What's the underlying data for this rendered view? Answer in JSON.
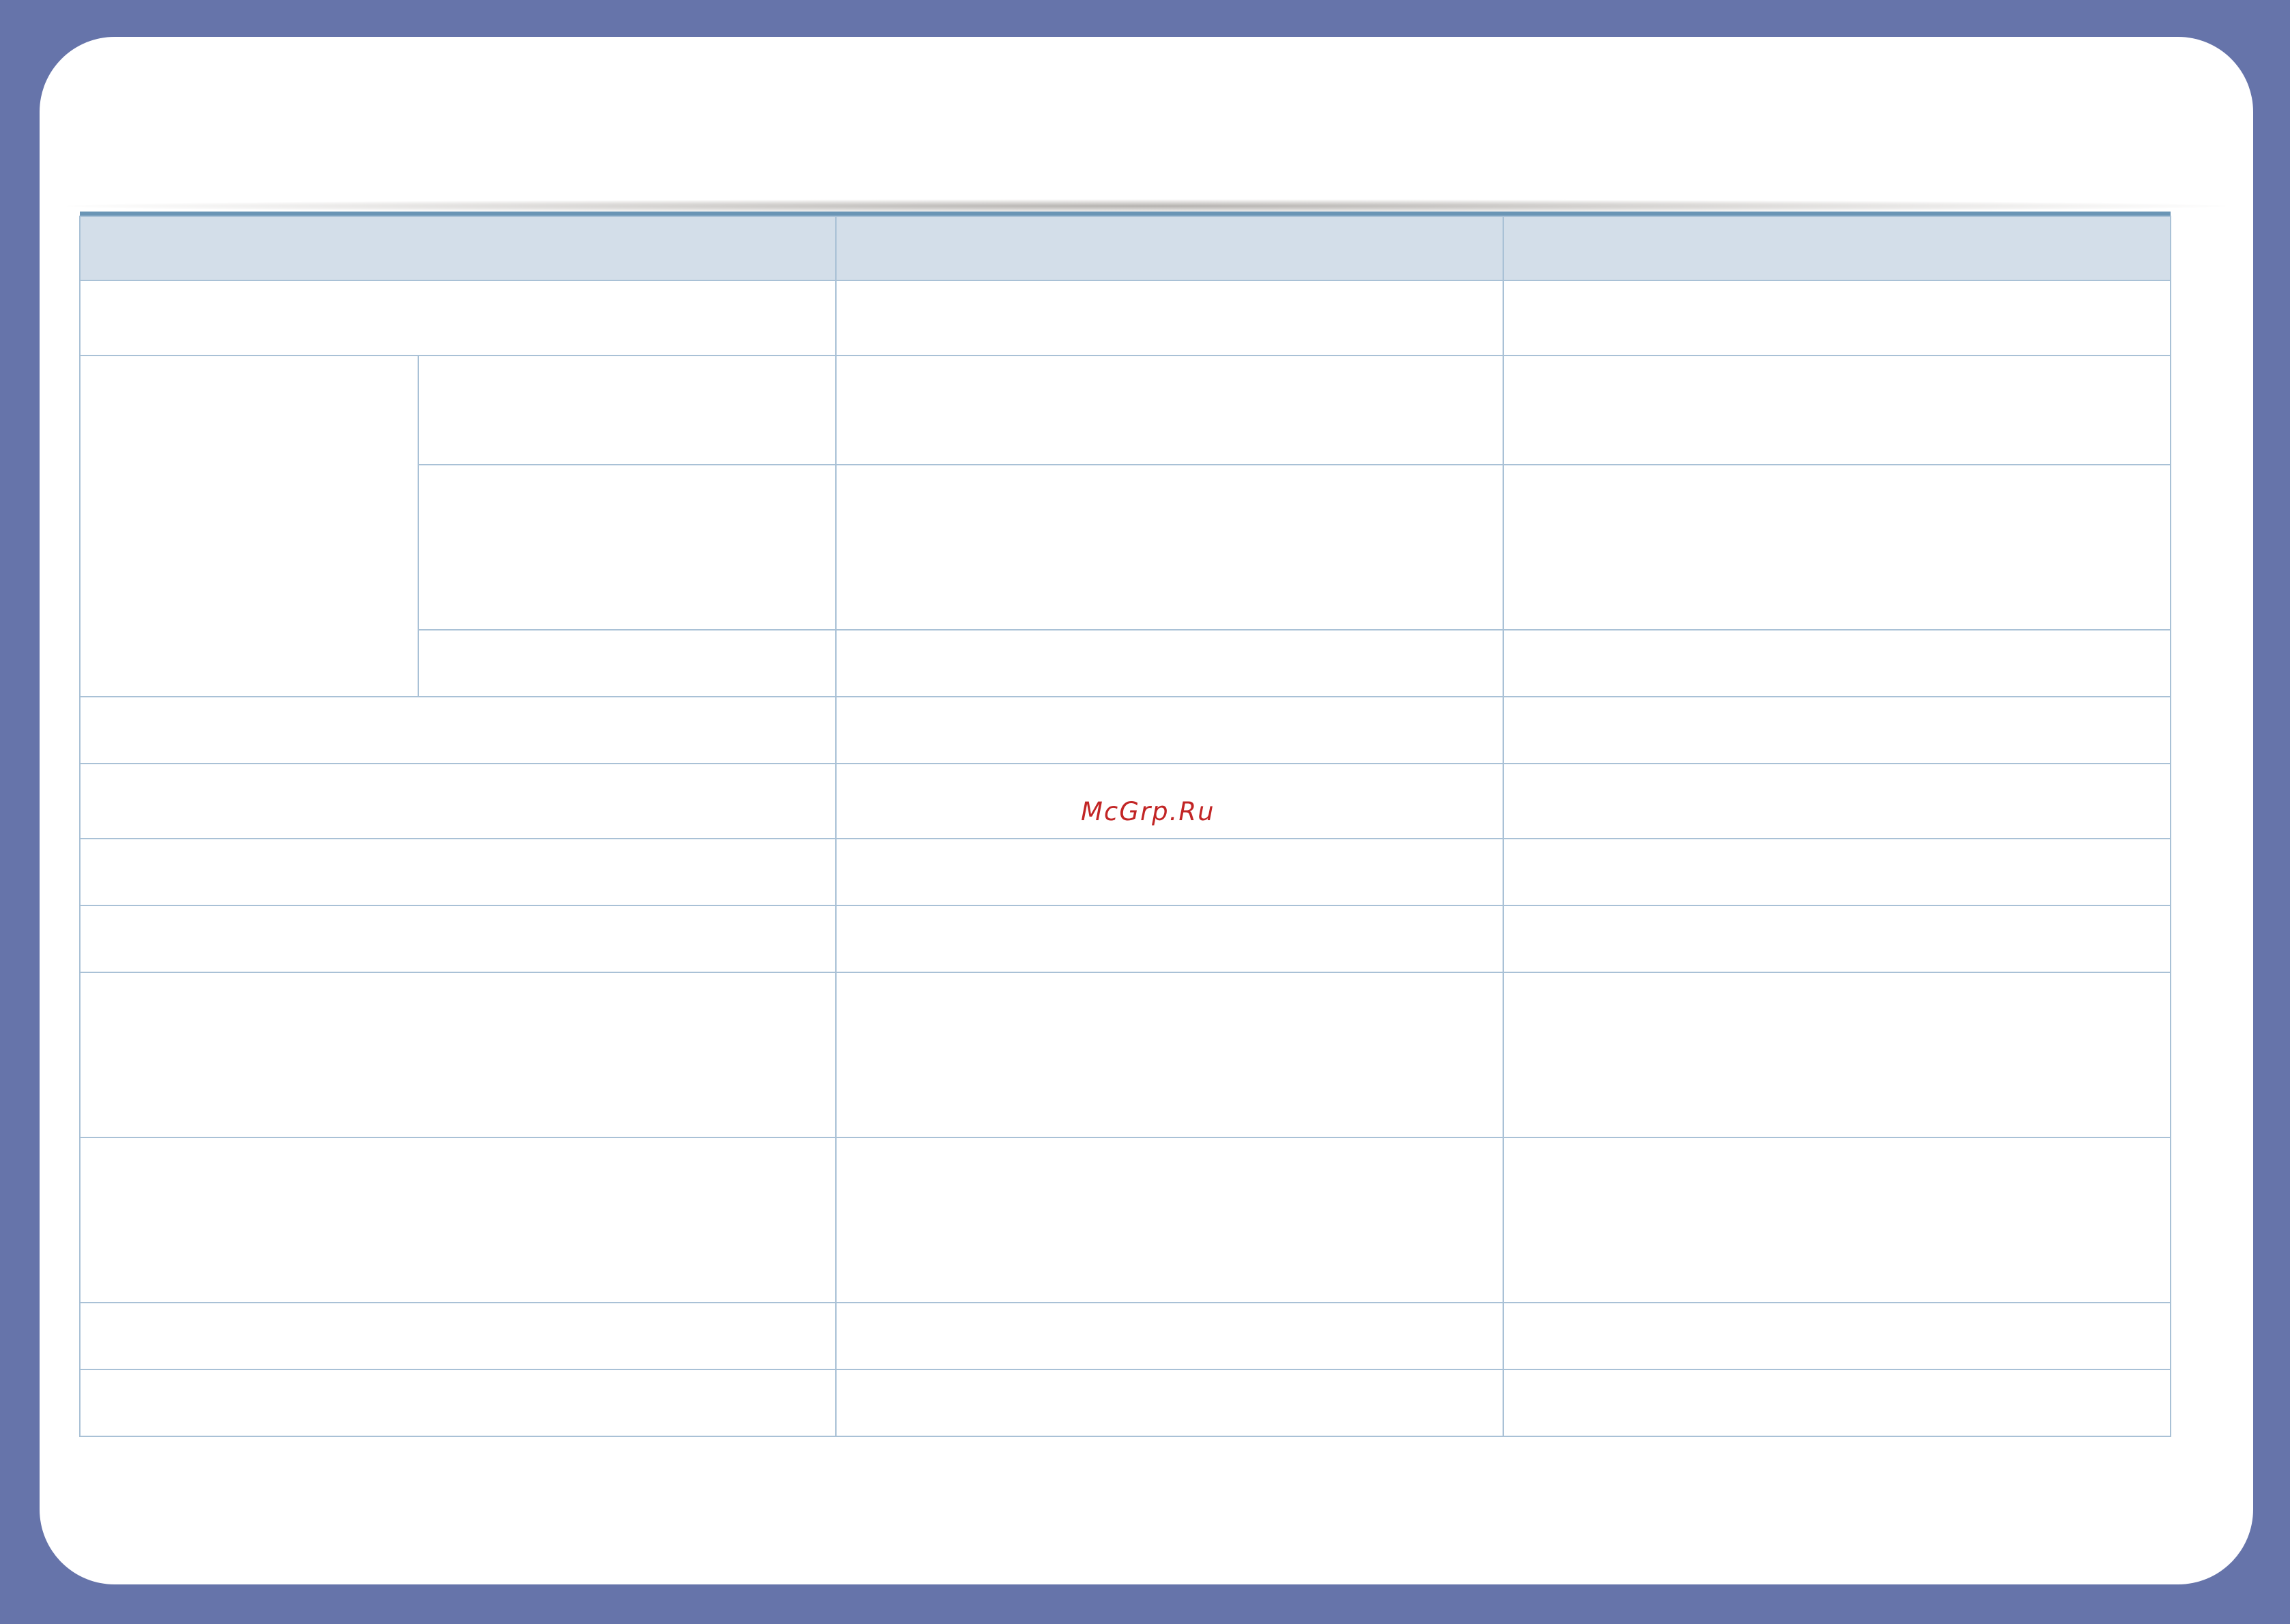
{
  "watermark": {
    "text": "McGrp.Ru"
  },
  "table": {
    "header": [
      "",
      "",
      ""
    ],
    "rows": [
      [
        "",
        "",
        ""
      ],
      [
        "",
        "",
        "",
        ""
      ],
      [
        "",
        "",
        ""
      ],
      [
        "",
        "",
        ""
      ],
      [
        "",
        "",
        ""
      ],
      [
        "",
        "",
        ""
      ],
      [
        "",
        "",
        ""
      ],
      [
        "",
        "",
        ""
      ],
      [
        "",
        "",
        ""
      ],
      [
        "",
        "",
        ""
      ],
      [
        "",
        "",
        ""
      ],
      [
        "",
        "",
        ""
      ]
    ]
  },
  "colors": {
    "frame": "#6674aa",
    "header_fill": "#d3dee9",
    "top_rule": "#6a95b5",
    "grid": "#a9c1d6",
    "watermark": "#c22525"
  }
}
